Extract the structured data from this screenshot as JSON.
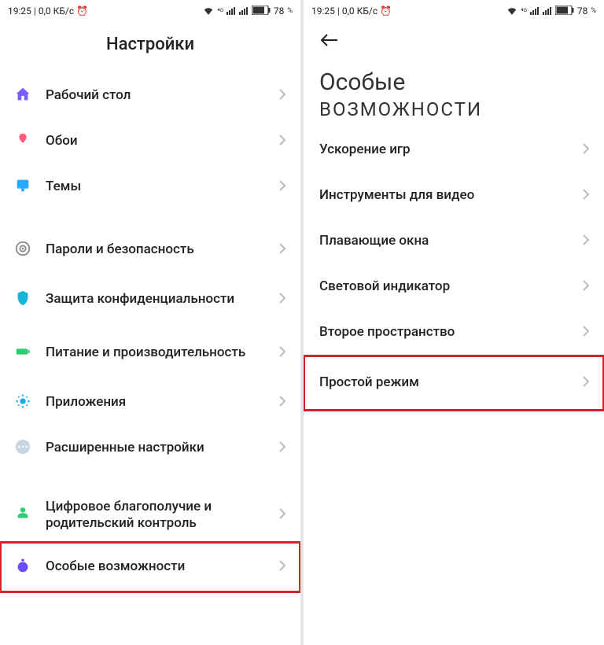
{
  "status": {
    "time": "19:25",
    "net_speed": "0,0 КБ/с",
    "battery_pct": "78",
    "battery_suffix": "%"
  },
  "left": {
    "title": "Настройки",
    "items": [
      {
        "icon": "home-icon",
        "label": "Рабочий стол"
      },
      {
        "icon": "wallpaper-icon",
        "label": "Обои"
      },
      {
        "icon": "themes-icon",
        "label": "Темы"
      }
    ],
    "items2": [
      {
        "icon": "security-icon",
        "label": "Пароли и безопасность"
      },
      {
        "icon": "privacy-icon",
        "label": "Защита конфиденциальности"
      },
      {
        "icon": "battery-icon",
        "label": "Питание и производительность"
      },
      {
        "icon": "apps-icon",
        "label": "Приложения"
      },
      {
        "icon": "more-icon",
        "label": "Расширенные настройки"
      }
    ],
    "items3": [
      {
        "icon": "wellbeing-icon",
        "label": "Цифровое благополучие и родительский контроль"
      },
      {
        "icon": "special-icon",
        "label": "Особые возможности",
        "highlight": true
      }
    ]
  },
  "right": {
    "title_line1": "Особые",
    "title_line2": "возможности",
    "items": [
      {
        "label": "Ускорение игр"
      },
      {
        "label": "Инструменты для видео"
      },
      {
        "label": "Плавающие окна"
      },
      {
        "label": "Световой индикатор"
      },
      {
        "label": "Второе пространство"
      },
      {
        "label": "Простой режим",
        "highlight": true
      }
    ]
  }
}
